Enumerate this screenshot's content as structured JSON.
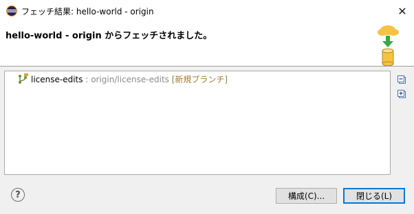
{
  "window": {
    "title": "フェッチ結果: hello-world - origin",
    "close_glyph": "✕"
  },
  "header": {
    "repo": "hello-world",
    "dash": " - ",
    "remote": "origin",
    "message_suffix": " からフェッチされました。"
  },
  "tree": {
    "items": [
      {
        "label": "license-edits",
        "separator": " : ",
        "remote_ref": "origin/license-edits",
        "status": " [新規ブランチ]"
      }
    ]
  },
  "side_buttons": {
    "collapse_icon": "collapse-all-icon",
    "expand_icon": "expand-all-icon"
  },
  "footer": {
    "help_glyph": "?",
    "config_label": "構成(C)...",
    "close_label": "閉じる(L)"
  },
  "colors": {
    "accent": "#0078d7",
    "remote_text": "#8a8a8a",
    "status_text": "#a07a38"
  }
}
